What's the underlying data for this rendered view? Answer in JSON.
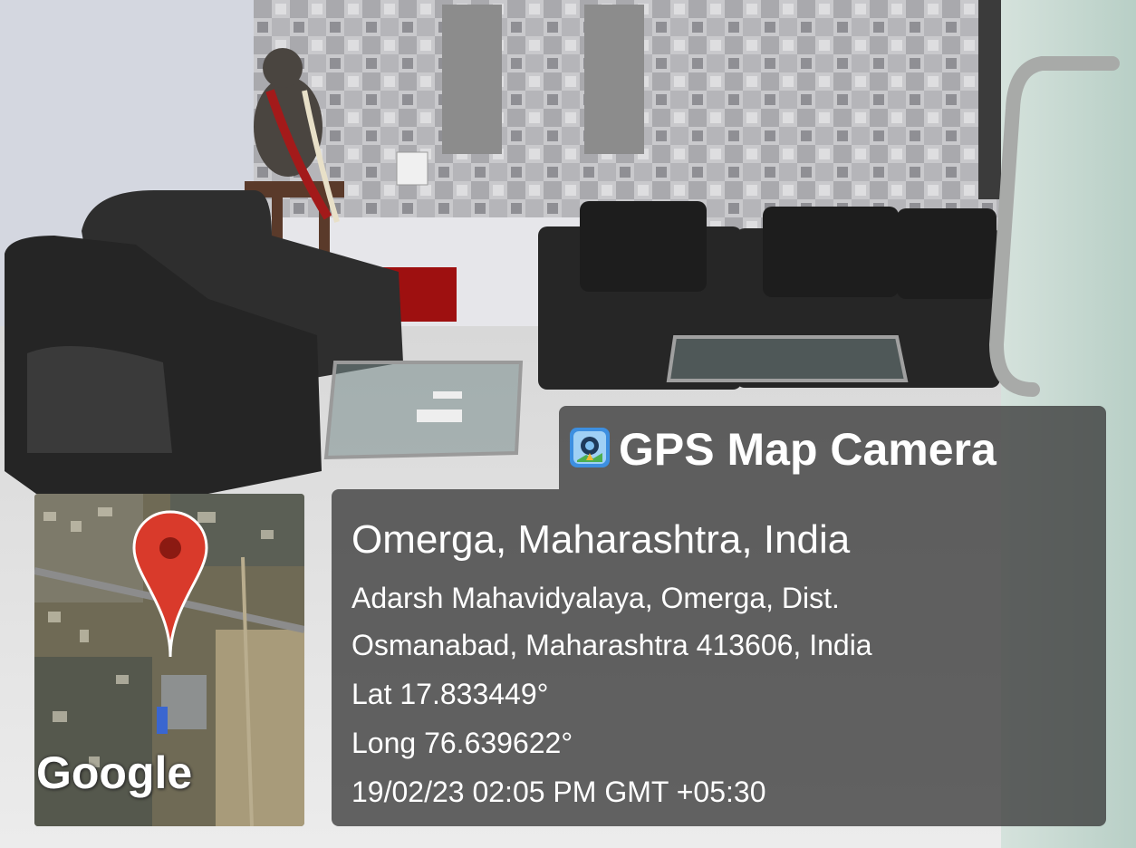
{
  "app": {
    "title": "GPS Map Camera",
    "icon": "gps-camera-app-icon"
  },
  "location": {
    "place": "Omerga, Maharashtra, India",
    "address_line1": "Adarsh Mahavidyalaya, Omerga, Dist.",
    "address_line2": "Osmanabad, Maharashtra 413606, India",
    "latitude": "Lat 17.833449°",
    "longitude": "Long 76.639622°",
    "datetime": "19/02/23 02:05 PM GMT +05:30"
  },
  "map": {
    "attribution": "Google",
    "marker_color": "#d93a2b"
  },
  "colors": {
    "overlay": "#3a3a3a",
    "text": "#ffffff"
  }
}
